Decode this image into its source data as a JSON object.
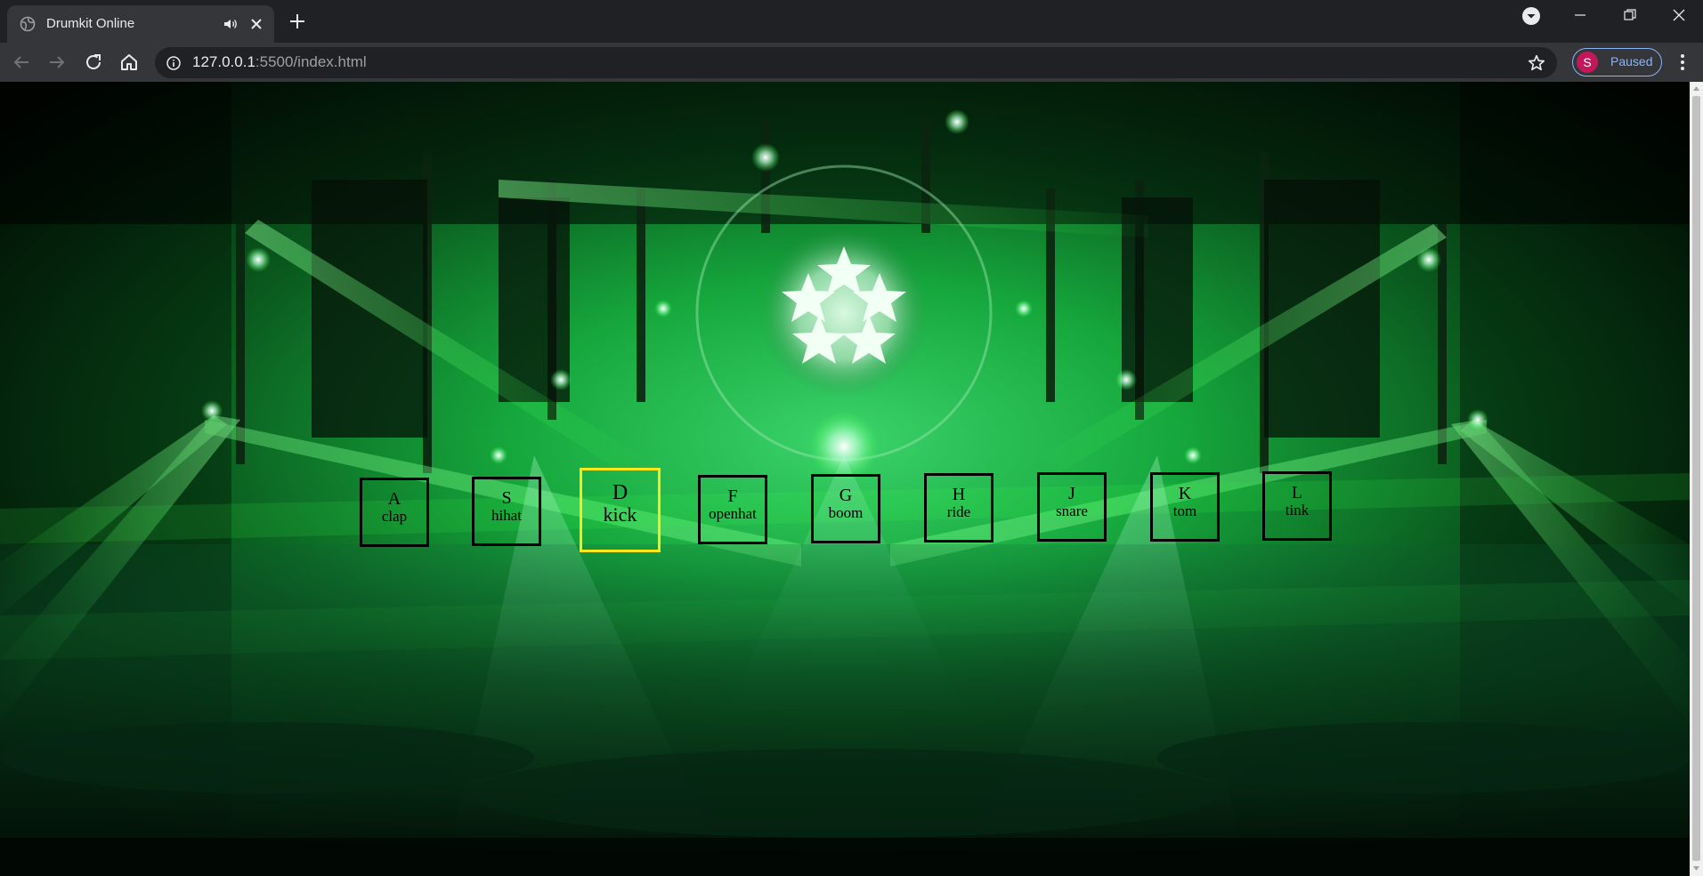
{
  "browser": {
    "tab_title": "Drumkit Online",
    "url_host": "127.0.0.1",
    "url_path": ":5500/index.html",
    "profile_initial": "S",
    "profile_status": "Paused"
  },
  "colors": {
    "chrome_dark": "#202124",
    "chrome_toolbar": "#35363a",
    "profile_avatar": "#c2185b",
    "profile_accent": "#8ab4f8",
    "laser_green": "#39ff4a",
    "key_border": "#000000",
    "playing_border": "#ffe81a"
  },
  "keys": [
    {
      "key": "A",
      "sound": "clap",
      "playing": false
    },
    {
      "key": "S",
      "sound": "hihat",
      "playing": false
    },
    {
      "key": "D",
      "sound": "kick",
      "playing": true
    },
    {
      "key": "F",
      "sound": "openhat",
      "playing": false
    },
    {
      "key": "G",
      "sound": "boom",
      "playing": false
    },
    {
      "key": "H",
      "sound": "ride",
      "playing": false
    },
    {
      "key": "J",
      "sound": "snare",
      "playing": false
    },
    {
      "key": "K",
      "sound": "tom",
      "playing": false
    },
    {
      "key": "L",
      "sound": "tink",
      "playing": false
    }
  ]
}
